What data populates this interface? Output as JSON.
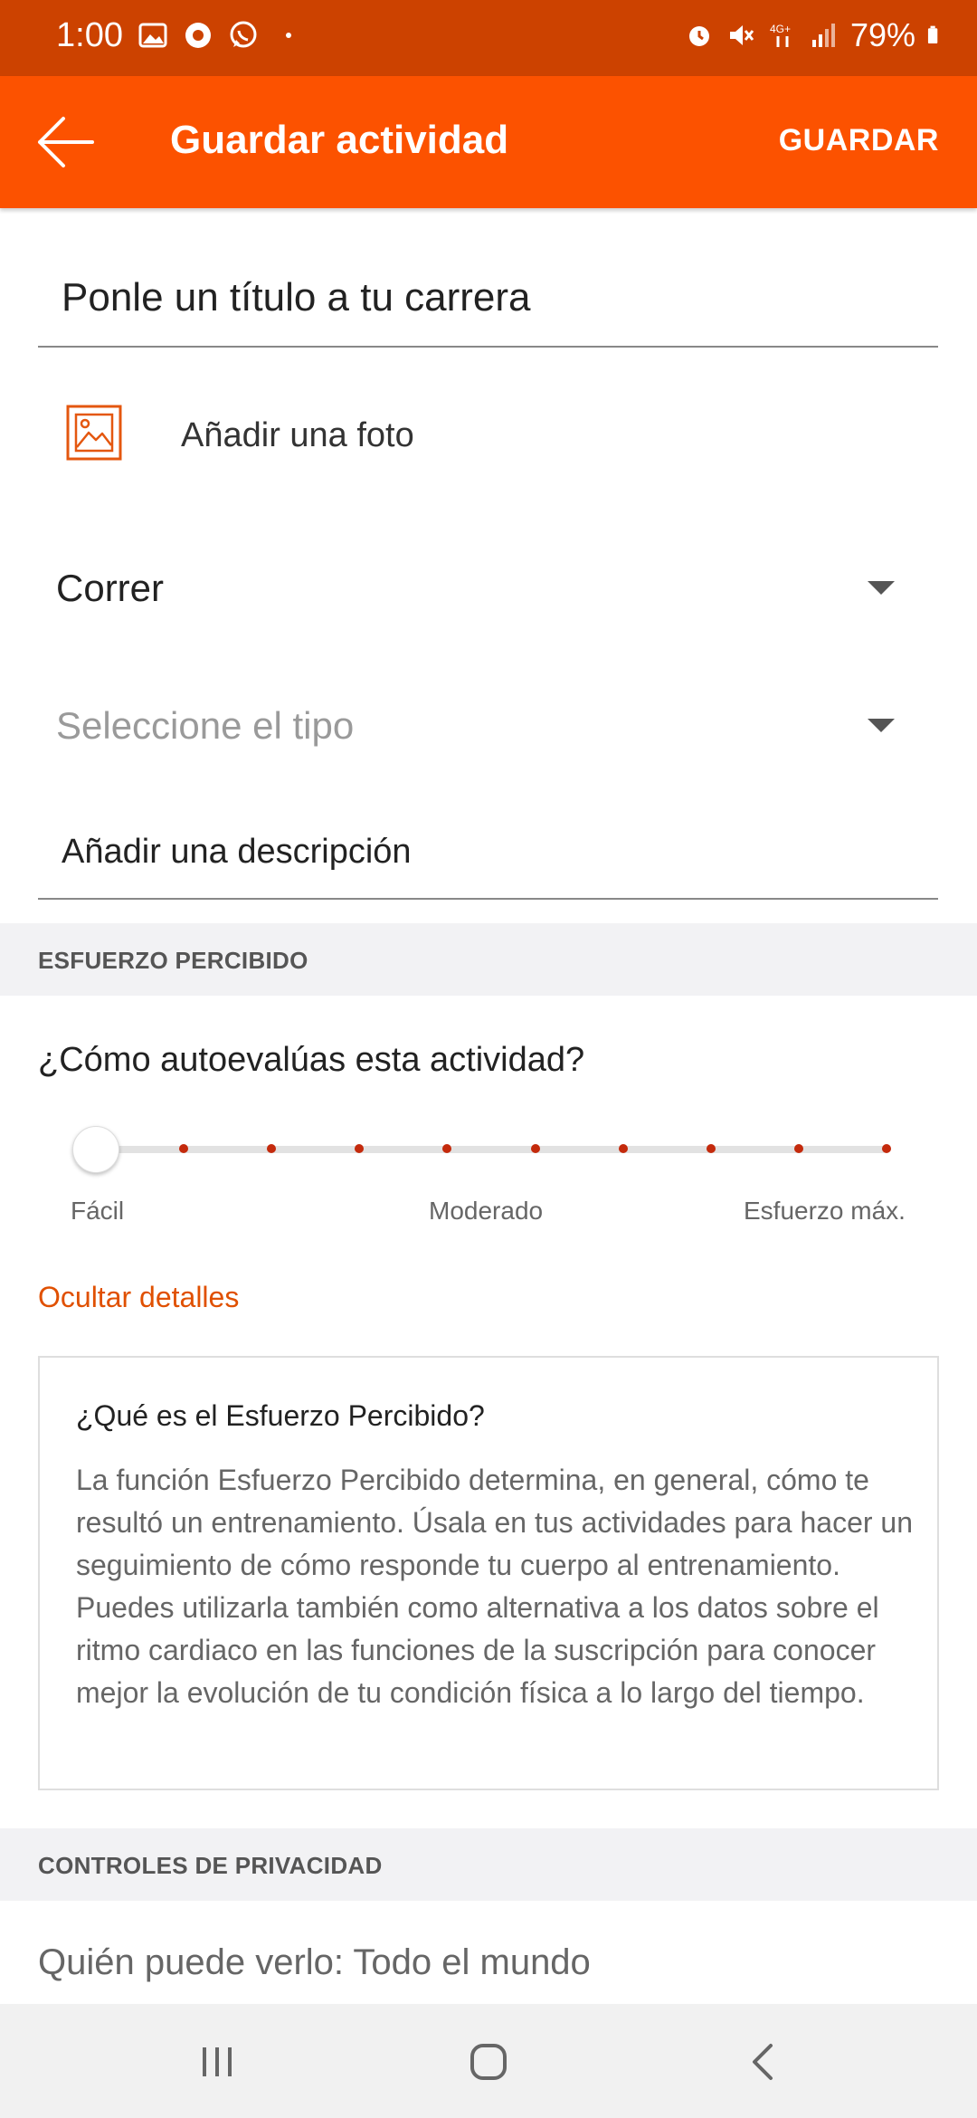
{
  "status_bar": {
    "time": "1:00",
    "battery": "79%",
    "network": "4G+"
  },
  "app_bar": {
    "title": "Guardar actividad",
    "save_label": "GUARDAR"
  },
  "form": {
    "title_value": "Ponle un título a tu carrera",
    "photo_label": "Añadir una foto",
    "sport_value": "Correr",
    "type_placeholder": "Seleccione el tipo",
    "description_value": "Añadir una descripción"
  },
  "effort": {
    "section_title": "ESFUERZO PERCIBIDO",
    "question": "¿Cómo autoevalúas esta actividad?",
    "slider_value": 0,
    "slider_steps": 10,
    "labels": {
      "easy": "Fácil",
      "moderate": "Moderado",
      "max": "Esfuerzo máx."
    },
    "hide_details_label": "Ocultar detalles",
    "info_title": "¿Qué es el Esfuerzo Percibido?",
    "info_body": "La función Esfuerzo Percibido determina, en general, cómo te resultó un entrenamiento. Úsala en tus actividades para hacer un seguimiento de cómo responde tu cuerpo al entrenamiento. Puedes utilizarla también como alternativa a los datos sobre el ritmo cardiaco en las funciones de la suscripción para conocer mejor la evolución de tu condición física a lo largo del tiempo."
  },
  "privacy": {
    "section_title": "CONTROLES DE PRIVACIDAD",
    "visibility_label": "Quién puede verlo: Todo el mundo"
  },
  "colors": {
    "status_bar": "#cc4200",
    "accent": "#fc5200",
    "link": "#e05000",
    "slider_dot": "#c42a0c"
  }
}
